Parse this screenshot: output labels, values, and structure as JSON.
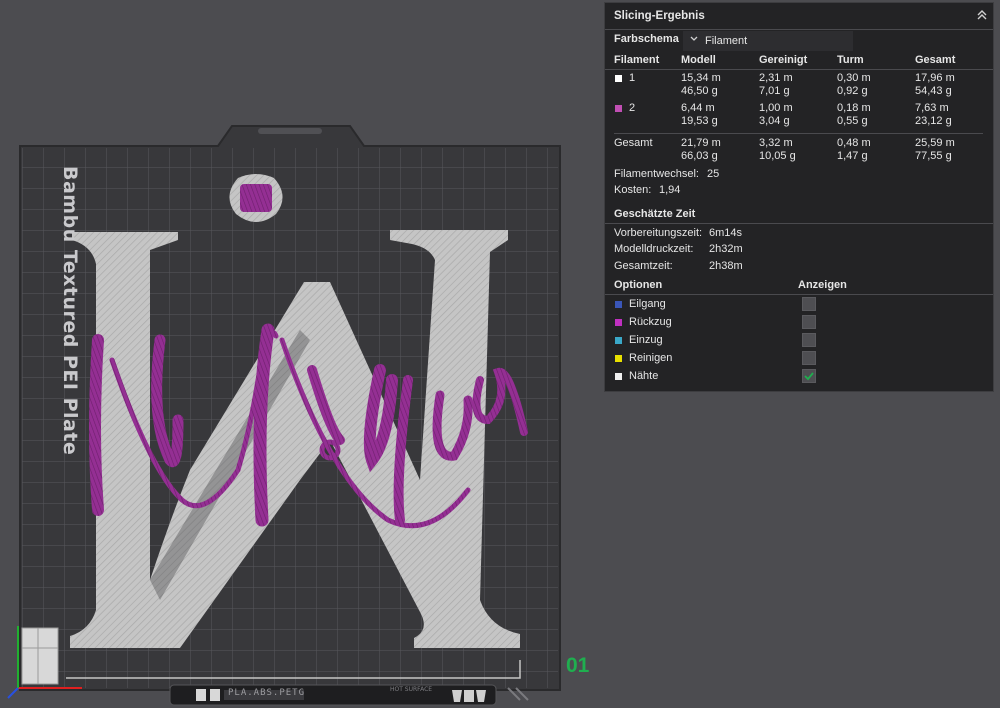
{
  "viewport": {
    "plate_label": "Bambu Textured PEI Plate",
    "plate_number": "01",
    "bottom_bar_text": "PLA.ABS.PETG",
    "hot_surface": "HOT SURFACE"
  },
  "panel": {
    "title": "Slicing-Ergebnis",
    "color_scheme_label": "Farbschema",
    "color_scheme_value": "Filament",
    "headers": [
      "Filament",
      "Modell",
      "Gereinigt",
      "Turm",
      "Gesamt"
    ],
    "filaments": [
      {
        "id": "1",
        "color": "#ffffff",
        "modell": [
          "15,34 m",
          "46,50 g"
        ],
        "gereinigt": [
          "2,31 m",
          "7,01 g"
        ],
        "turm": [
          "0,30 m",
          "0,92 g"
        ],
        "gesamt": [
          "17,96 m",
          "54,43 g"
        ]
      },
      {
        "id": "2",
        "color": "#c14fb4",
        "modell": [
          "6,44 m",
          "19,53 g"
        ],
        "gereinigt": [
          "1,00 m",
          "3,04 g"
        ],
        "turm": [
          "0,18 m",
          "0,55 g"
        ],
        "gesamt": [
          "7,63 m",
          "23,12 g"
        ]
      }
    ],
    "total": {
      "label": "Gesamt",
      "modell": [
        "21,79 m",
        "66,03 g"
      ],
      "gereinigt": [
        "3,32 m",
        "10,05 g"
      ],
      "turm": [
        "0,48 m",
        "1,47 g"
      ],
      "gesamt": [
        "25,59 m",
        "77,55 g"
      ]
    },
    "filament_changes_label": "Filamentwechsel:",
    "filament_changes_value": "25",
    "cost_label": "Kosten:",
    "cost_value": "1,94",
    "time_section": "Geschätzte Zeit",
    "prep_time_label": "Vorbereitungszeit:",
    "prep_time_value": "6m14s",
    "model_time_label": "Modelldruckzeit:",
    "model_time_value": "2h32m",
    "total_time_label": "Gesamtzeit:",
    "total_time_value": "2h38m",
    "options_label": "Optionen",
    "show_label": "Anzeigen",
    "options": [
      {
        "label": "Eilgang",
        "color": "#3a56b8",
        "checked": false
      },
      {
        "label": "Rückzug",
        "color": "#c030c0",
        "checked": false
      },
      {
        "label": "Einzug",
        "color": "#3aa8c8",
        "checked": false
      },
      {
        "label": "Reinigen",
        "color": "#e8e000",
        "checked": false
      },
      {
        "label": "Nähte",
        "color": "#f0f0f0",
        "checked": true
      }
    ]
  },
  "colors": {
    "accent_green": "#1fae4f",
    "plate": "#3a3a3d",
    "model_white": "#c8c8c8",
    "model_purple": "#8e2a8c"
  }
}
